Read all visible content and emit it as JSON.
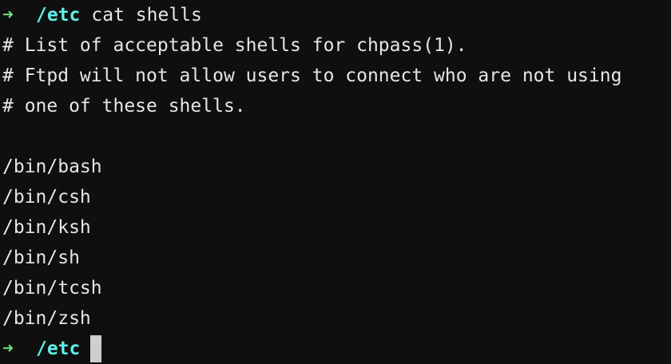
{
  "terminal": {
    "prompt_symbol": "➜",
    "prompt_cwd": "/etc",
    "command": "cat shells",
    "output": [
      "# List of acceptable shells for chpass(1).",
      "# Ftpd will not allow users to connect who are not using",
      "# one of these shells.",
      "",
      "/bin/bash",
      "/bin/csh",
      "/bin/ksh",
      "/bin/sh",
      "/bin/tcsh",
      "/bin/zsh"
    ],
    "final_prompt_symbol": "➜",
    "final_prompt_cwd": "/etc"
  },
  "colors": {
    "background": "#0f0f0f",
    "text": "#e6e6e6",
    "prompt_arrow": "#6ee07a",
    "cwd": "#5ef0e8",
    "cursor": "#cfcfcf"
  }
}
